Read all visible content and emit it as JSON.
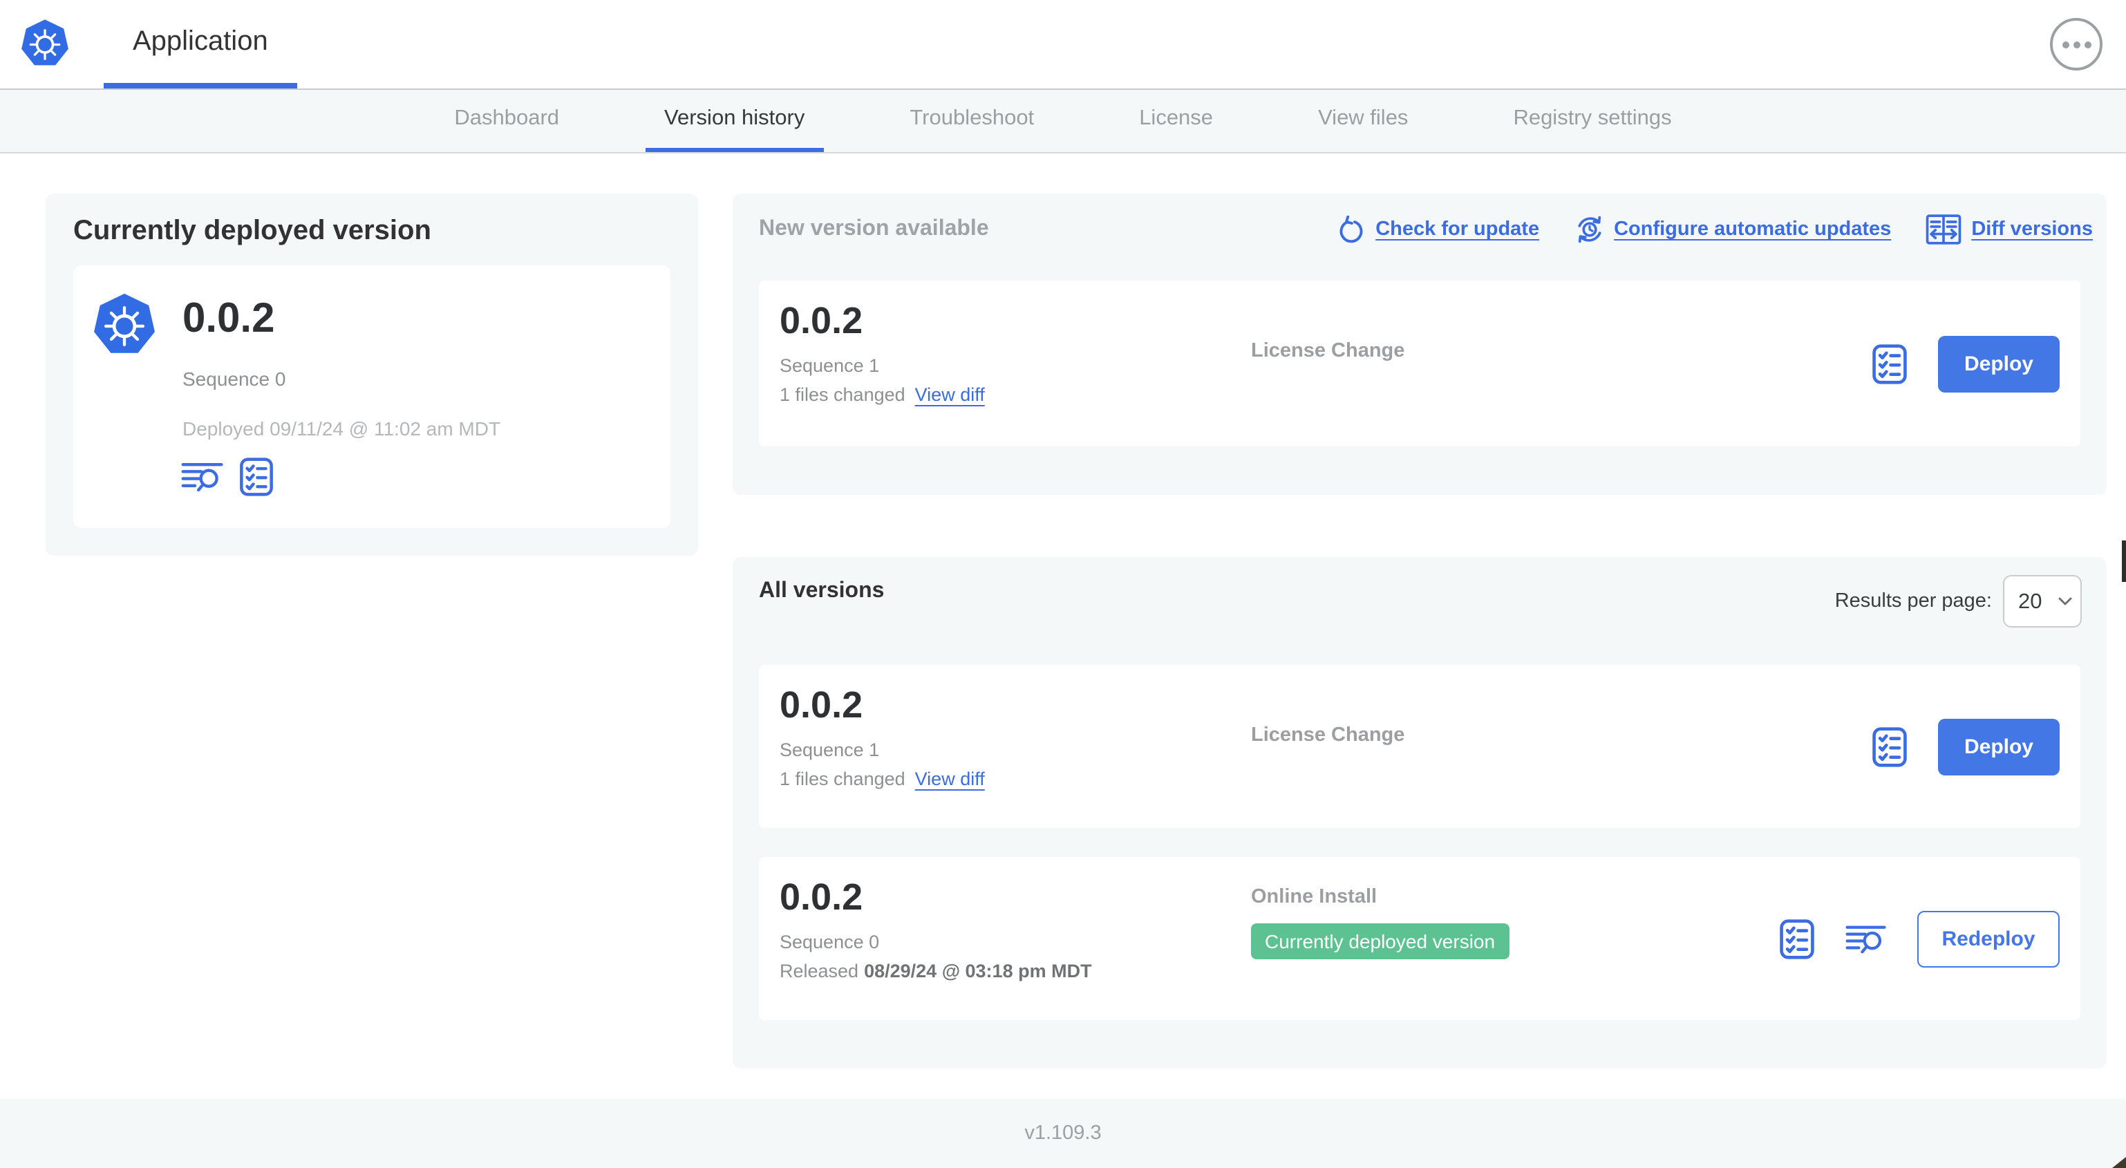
{
  "header": {
    "app_tab": "Application",
    "menu_icon": "ellipsis-icon",
    "logo_icon": "kubernetes-logo"
  },
  "nav": {
    "tabs": [
      {
        "label": "Dashboard",
        "active": false
      },
      {
        "label": "Version history",
        "active": true
      },
      {
        "label": "Troubleshoot",
        "active": false
      },
      {
        "label": "License",
        "active": false
      },
      {
        "label": "View files",
        "active": false
      },
      {
        "label": "Registry settings",
        "active": false
      }
    ]
  },
  "deployed_panel": {
    "title": "Currently deployed version",
    "version": "0.0.2",
    "sequence": "Sequence 0",
    "deployed_at": "Deployed 09/11/24 @ 11:02 am MDT",
    "icons": [
      "logs-icon",
      "checklist-icon"
    ]
  },
  "new_version_panel": {
    "title": "New version available",
    "actions": [
      {
        "icon": "refresh-icon",
        "label": "Check for update"
      },
      {
        "icon": "clock-refresh-icon",
        "label": "Configure automatic updates"
      },
      {
        "icon": "diff-icon",
        "label": "Diff versions"
      }
    ],
    "card": {
      "version": "0.0.2",
      "sequence": "Sequence 1",
      "files_changed": "1 files changed",
      "view_diff": "View diff",
      "source": "License Change",
      "deploy": "Deploy",
      "icons": [
        "checklist-icon"
      ]
    }
  },
  "all_versions_panel": {
    "title": "All versions",
    "results_per_page_label": "Results per page:",
    "results_per_page": "20",
    "rows": [
      {
        "version": "0.0.2",
        "sequence": "Sequence 1",
        "files_changed": "1 files changed",
        "view_diff": "View diff",
        "source": "License Change",
        "deploy": "Deploy",
        "icons": [
          "checklist-icon"
        ]
      },
      {
        "version": "0.0.2",
        "sequence": "Sequence 0",
        "released_prefix": "Released",
        "released_date": "08/29/24 @ 03:18 pm MDT",
        "source": "Online Install",
        "badge": "Currently deployed version",
        "redeploy": "Redeploy",
        "icons": [
          "checklist-icon",
          "logs-icon"
        ]
      }
    ]
  },
  "footer": {
    "app_version": "v1.109.3"
  },
  "colors": {
    "accent_blue": "#3b6ce1",
    "button_blue": "#4377e6",
    "badge_green": "#5cc291",
    "kubernetes_blue": "#326ce5",
    "panel_bg": "#f5f8f9",
    "heading_text": "#323232",
    "muted_text": "#9b9fa2"
  }
}
